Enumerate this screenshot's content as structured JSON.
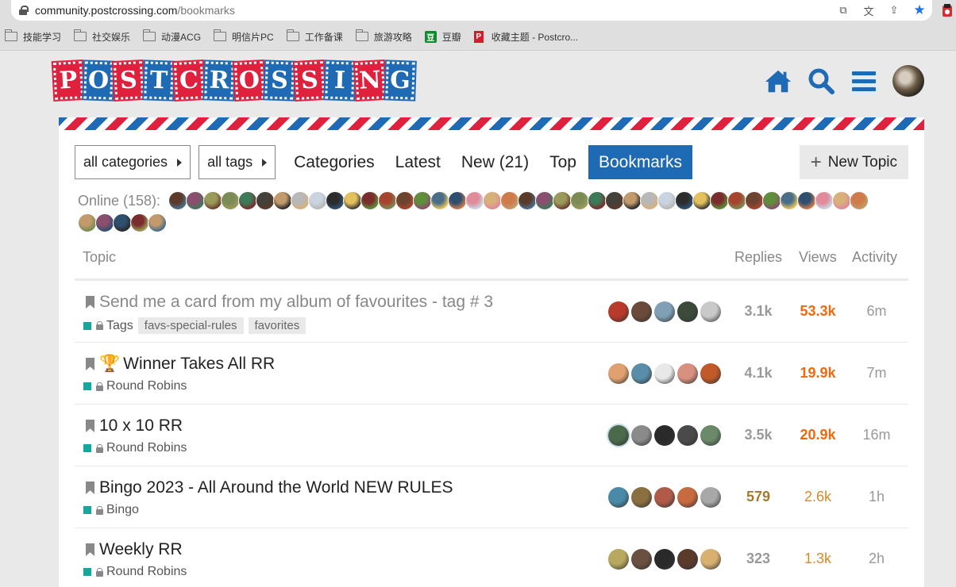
{
  "browser": {
    "url_host": "community.postcrossing.com",
    "url_path": "/bookmarks",
    "bookmarks": [
      {
        "label": "技能学习",
        "icon": "folder-icon"
      },
      {
        "label": "社交娱乐",
        "icon": "folder-icon"
      },
      {
        "label": "动漫ACG",
        "icon": "folder-icon"
      },
      {
        "label": "明信片PC",
        "icon": "folder-icon"
      },
      {
        "label": "工作备课",
        "icon": "folder-icon"
      },
      {
        "label": "旅游攻略",
        "icon": "folder-icon"
      },
      {
        "label": "豆瓣",
        "icon": "douban-icon"
      },
      {
        "label": "收藏主题 - Postcro...",
        "icon": "postcrossing-favicon"
      }
    ]
  },
  "site": {
    "logo_letters": [
      "P",
      "O",
      "S",
      "T",
      "C",
      "R",
      "O",
      "S",
      "S",
      "I",
      "N",
      "G"
    ],
    "logo_colors": {
      "red": "#e0213e",
      "blue": "#1f6ab4"
    }
  },
  "nav": {
    "all_categories": "all categories",
    "all_tags": "all tags",
    "links": [
      "Categories",
      "Latest",
      "New (21)",
      "Top",
      "Bookmarks"
    ],
    "active": "Bookmarks",
    "new_topic": "New Topic"
  },
  "online": {
    "label": "Online (158):"
  },
  "table": {
    "headers": {
      "topic": "Topic",
      "replies": "Replies",
      "views": "Views",
      "activity": "Activity"
    },
    "rows": [
      {
        "title": "Send me a card from my album of favourites - tag # 3",
        "read": true,
        "trophy": false,
        "category": "Tags",
        "tags": [
          "favs-special-rules",
          "favorites"
        ],
        "replies": "3.1k",
        "views": "53.3k",
        "activity": "6m"
      },
      {
        "title": "Winner Takes All RR",
        "read": false,
        "trophy": true,
        "category": "Round Robins",
        "tags": [],
        "replies": "4.1k",
        "views": "19.9k",
        "activity": "7m"
      },
      {
        "title": "10 x 10 RR",
        "read": false,
        "trophy": false,
        "category": "Round Robins",
        "tags": [],
        "replies": "3.5k",
        "views": "20.9k",
        "activity": "16m"
      },
      {
        "title": "Bingo 2023 - All Around the World NEW RULES",
        "read": false,
        "trophy": false,
        "category": "Bingo",
        "tags": [],
        "replies": "579",
        "views": "2.6k",
        "activity": "1h"
      },
      {
        "title": "Weekly RR",
        "read": false,
        "trophy": false,
        "category": "Round Robins",
        "tags": [],
        "replies": "323",
        "views": "1.3k",
        "activity": "2h"
      }
    ]
  },
  "colors": {
    "accent": "#1f6ab4",
    "category": "#12a89d",
    "views_hot": "#f0690e",
    "views_warm": "#d98a28",
    "replies_warm": "#a8782e"
  }
}
